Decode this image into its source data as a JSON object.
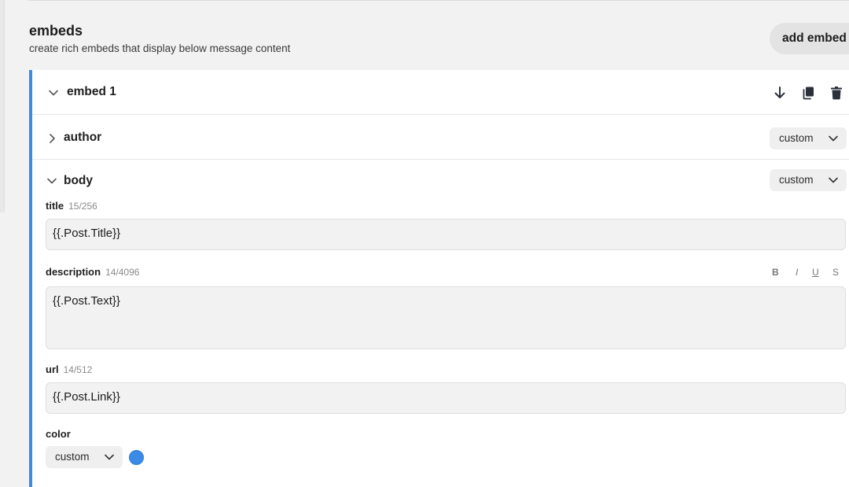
{
  "section": {
    "title": "embeds",
    "subtitle": "create rich embeds that display below message content",
    "add_button": "add embed"
  },
  "embed": {
    "title": "embed 1",
    "author": {
      "label": "author",
      "mode": "custom"
    },
    "body": {
      "label": "body",
      "mode": "custom",
      "title_field": {
        "label": "title",
        "count": "15/256",
        "value": "{{.Post.Title}}"
      },
      "description_field": {
        "label": "description",
        "count": "14/4096",
        "value": "{{.Post.Text}}"
      },
      "url_field": {
        "label": "url",
        "count": "14/512",
        "value": "{{.Post.Link}}"
      },
      "color_field": {
        "label": "color",
        "mode": "custom",
        "swatch_color": "#3b8ae6"
      }
    },
    "format_buttons": [
      "B",
      "I",
      "U",
      "S"
    ]
  },
  "icons": {
    "collapse": "chevron-down-icon",
    "expand": "chevron-right-icon",
    "move_down": "arrow-down-icon",
    "duplicate": "copy-icon",
    "delete": "trash-icon"
  },
  "colors": {
    "accent": "#3b8ae6",
    "background": "#f2f2f2",
    "card": "#ffffff"
  }
}
